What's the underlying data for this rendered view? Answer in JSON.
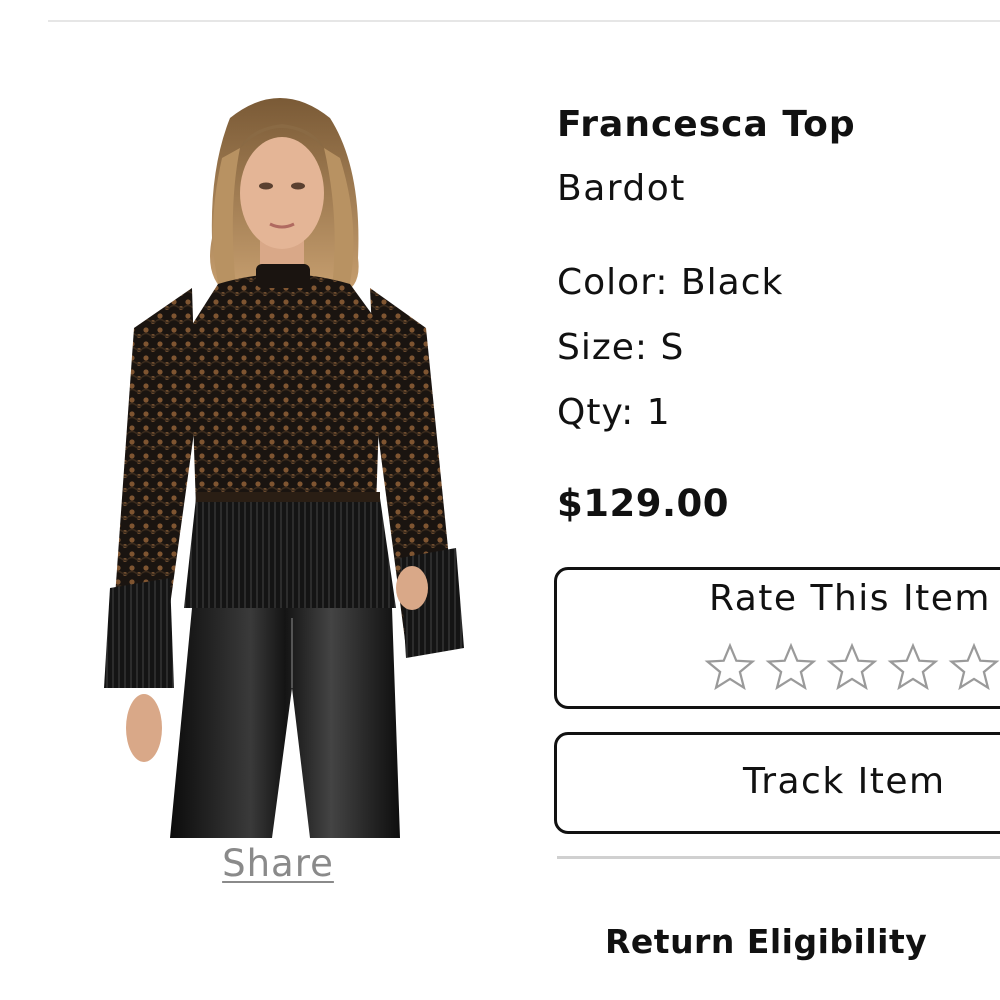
{
  "product": {
    "name": "Francesca Top",
    "brand": "Bardot",
    "color": "Color: Black",
    "size": "Size: S",
    "qty": "Qty: 1",
    "price": "$129.00",
    "image_alt": "model wearing black lace top with bell sleeves and black leather pants"
  },
  "share": {
    "label": "Share"
  },
  "rating": {
    "title": "Rate This Item",
    "max_stars": 5,
    "current_rating": 0,
    "star_icon": "star-outline-icon"
  },
  "track": {
    "label": "Track Item"
  },
  "returns": {
    "heading": "Return Eligibility"
  },
  "colors": {
    "text": "#111111",
    "share_link": "#8a8a8a",
    "divider": "#d0d0d0",
    "star_outline": "#9a9a9a"
  }
}
